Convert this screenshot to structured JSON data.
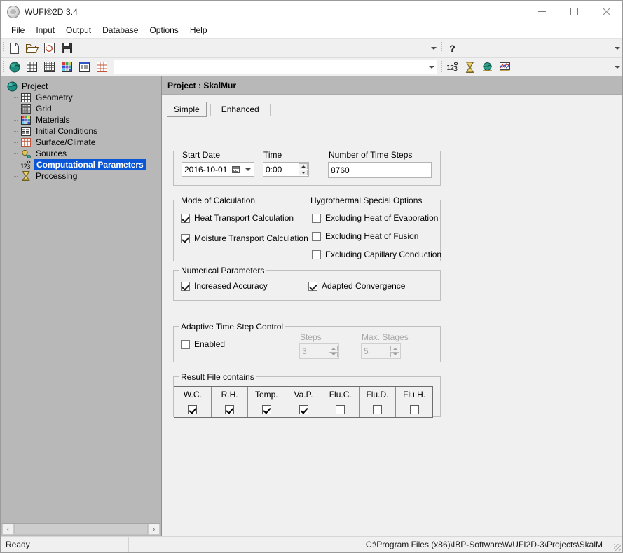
{
  "window": {
    "title": "WUFI®2D 3.4",
    "app_icon": "wufi-globe-icon",
    "minimize_label": "Minimize",
    "maximize_label": "Maximize",
    "close_label": "Close"
  },
  "menubar": {
    "items": [
      {
        "label": "File"
      },
      {
        "label": "Input"
      },
      {
        "label": "Output"
      },
      {
        "label": "Database"
      },
      {
        "label": "Options"
      },
      {
        "label": "Help"
      }
    ]
  },
  "toolbar_top": {
    "buttons": [
      {
        "name": "new-document-icon"
      },
      {
        "name": "open-folder-icon"
      },
      {
        "name": "refresh-image-icon"
      },
      {
        "name": "save-floppy-icon"
      }
    ],
    "help_glyph": "?"
  },
  "toolbar_bottom": {
    "buttons": [
      {
        "name": "project-globe-icon"
      },
      {
        "name": "geometry-grid-icon"
      },
      {
        "name": "grid-mesh-icon"
      },
      {
        "name": "materials-palette-icon"
      },
      {
        "name": "initial-conditions-icon"
      },
      {
        "name": "surface-climate-icon"
      }
    ],
    "right_buttons": [
      {
        "name": "computational-parameters-icon"
      },
      {
        "name": "processing-hourglass-icon"
      },
      {
        "name": "results-globe-icon"
      },
      {
        "name": "chart-results-icon"
      }
    ]
  },
  "sidebar": {
    "items": [
      {
        "label": "Project",
        "icon": "globe-icon",
        "level": 0,
        "selected": false
      },
      {
        "label": "Geometry",
        "icon": "geometry-grid-icon",
        "level": 1,
        "selected": false
      },
      {
        "label": "Grid",
        "icon": "grid-mesh-icon",
        "level": 1,
        "selected": false
      },
      {
        "label": "Materials",
        "icon": "materials-palette-icon",
        "level": 1,
        "selected": false
      },
      {
        "label": "Initial Conditions",
        "icon": "initial-conditions-icon",
        "level": 1,
        "selected": false
      },
      {
        "label": "Surface/Climate",
        "icon": "surface-climate-icon",
        "level": 1,
        "selected": false
      },
      {
        "label": "Sources",
        "icon": "sources-icon",
        "level": 1,
        "selected": false
      },
      {
        "label": "Computational Parameters",
        "icon": "numbers-123-icon",
        "level": 1,
        "selected": true
      },
      {
        "label": "Processing",
        "icon": "hourglass-icon",
        "level": 1,
        "selected": false
      }
    ],
    "selection_color": "#0a56d6",
    "background_color": "#b8b8b8",
    "scroll_left_glyph": "‹",
    "scroll_right_glyph": "›"
  },
  "main": {
    "header": "Project : SkalMur",
    "tabs": [
      {
        "label": "Simple",
        "active": true
      },
      {
        "label": "Enhanced",
        "active": false
      }
    ],
    "date_group": {
      "start_date_label": "Start Date",
      "start_date_value": "2016-10-01",
      "time_label": "Time",
      "time_value": "0:00",
      "steps_label": "Number of Time Steps",
      "steps_value": "8760"
    },
    "mode_of_calculation": {
      "title": "Mode of Calculation",
      "options": [
        {
          "label": "Heat Transport Calculation",
          "checked": true
        },
        {
          "label": "Moisture Transport Calculation",
          "checked": true
        }
      ]
    },
    "hygrothermal_special_options": {
      "title": "Hygrothermal Special Options",
      "options": [
        {
          "label": "Excluding Heat of Evaporation",
          "checked": false
        },
        {
          "label": "Excluding Heat of Fusion",
          "checked": false
        },
        {
          "label": "Excluding Capillary Conduction",
          "checked": false
        }
      ]
    },
    "numerical_parameters": {
      "title": "Numerical Parameters",
      "options": [
        {
          "label": "Increased Accuracy",
          "checked": true
        },
        {
          "label": "Adapted Convergence",
          "checked": true
        }
      ]
    },
    "adaptive_time_step_control": {
      "title": "Adaptive Time Step Control",
      "enabled_label": "Enabled",
      "enabled_checked": false,
      "steps_label": "Steps",
      "steps_value": "3",
      "max_stages_label": "Max. Stages",
      "max_stages_value": "5"
    },
    "result_file_contains": {
      "title": "Result File contains",
      "columns": [
        "W.C.",
        "R.H.",
        "Temp.",
        "Va.P.",
        "Flu.C.",
        "Flu.D.",
        "Flu.H."
      ],
      "checked": [
        true,
        true,
        true,
        true,
        false,
        false,
        false
      ]
    }
  },
  "statusbar": {
    "status": "Ready",
    "path": "C:\\Program Files (x86)\\IBP-Software\\WUFI2D-3\\Projects\\SkalM"
  }
}
